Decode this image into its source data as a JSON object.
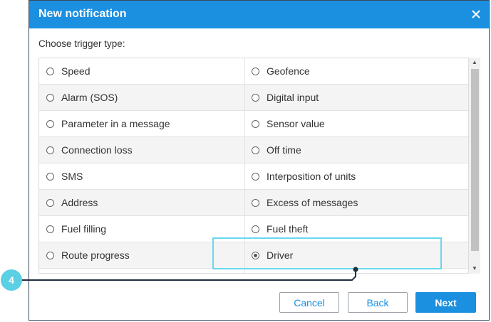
{
  "dialog": {
    "title": "New notification",
    "close_icon": "close-icon"
  },
  "prompt": "Choose trigger type:",
  "triggers": [
    [
      {
        "label": "Speed",
        "checked": false
      },
      {
        "label": "Geofence",
        "checked": false
      }
    ],
    [
      {
        "label": "Alarm (SOS)",
        "checked": false
      },
      {
        "label": "Digital input",
        "checked": false
      }
    ],
    [
      {
        "label": "Parameter in a message",
        "checked": false
      },
      {
        "label": "Sensor value",
        "checked": false
      }
    ],
    [
      {
        "label": "Connection loss",
        "checked": false
      },
      {
        "label": "Off time",
        "checked": false
      }
    ],
    [
      {
        "label": "SMS",
        "checked": false
      },
      {
        "label": "Interposition of units",
        "checked": false
      }
    ],
    [
      {
        "label": "Address",
        "checked": false
      },
      {
        "label": "Excess of messages",
        "checked": false
      }
    ],
    [
      {
        "label": "Fuel filling",
        "checked": false
      },
      {
        "label": "Fuel theft",
        "checked": false
      }
    ],
    [
      {
        "label": "Route progress",
        "checked": false
      },
      {
        "label": "Driver",
        "checked": true
      }
    ]
  ],
  "buttons": {
    "cancel": "Cancel",
    "back": "Back",
    "next": "Next"
  },
  "callout": {
    "step_number": "4",
    "color": "#5bcfe3"
  },
  "colors": {
    "accent": "#1b8fe0",
    "callout_line": "#1f2d3d"
  }
}
